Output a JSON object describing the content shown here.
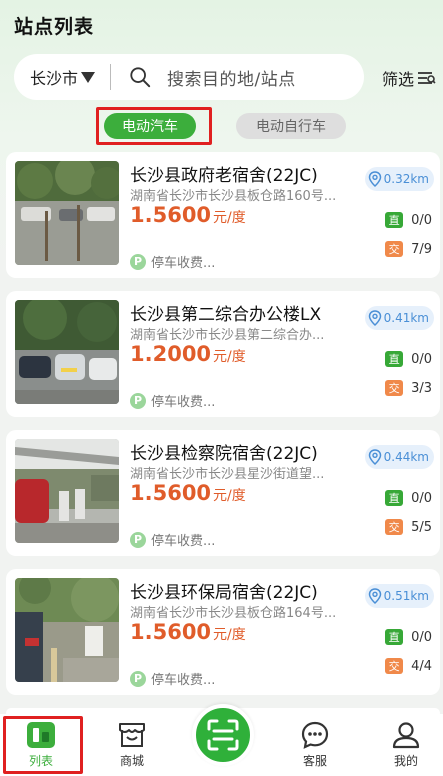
{
  "header": {
    "title": "站点列表"
  },
  "search": {
    "city": "长沙市",
    "placeholder": "搜索目的地/站点",
    "filter_label": "筛选"
  },
  "tabs": [
    {
      "label": "电动汽车",
      "active": true
    },
    {
      "label": "电动自行车",
      "active": false
    }
  ],
  "stations": [
    {
      "name": "长沙县政府老宿舍(22JC)",
      "address": "湖南省长沙市长沙县板仓路160号...",
      "price": "1.5600",
      "price_unit": "元/度",
      "parking": "停车收费...",
      "distance": "0.32km",
      "direct_label": "直",
      "direct": "0/0",
      "ac_label": "交",
      "ac": "7/9",
      "thumb_icon": "parking-lot-photo"
    },
    {
      "name": "长沙县第二综合办公楼LX",
      "address": "湖南省长沙市长沙县第二综合办...",
      "price": "1.2000",
      "price_unit": "元/度",
      "parking": "停车收费...",
      "distance": "0.41km",
      "direct_label": "直",
      "direct": "0/0",
      "ac_label": "交",
      "ac": "3/3",
      "thumb_icon": "parking-lot-photo"
    },
    {
      "name": "长沙县检察院宿舍(22JC)",
      "address": "湖南省长沙市长沙县星沙街道望...",
      "price": "1.5600",
      "price_unit": "元/度",
      "parking": "停车收费...",
      "distance": "0.44km",
      "direct_label": "直",
      "direct": "0/0",
      "ac_label": "交",
      "ac": "5/5",
      "thumb_icon": "carport-photo"
    },
    {
      "name": "长沙县环保局宿舍(22JC)",
      "address": "湖南省长沙市长沙县板仓路164号...",
      "price": "1.5600",
      "price_unit": "元/度",
      "parking": "停车收费...",
      "distance": "0.51km",
      "direct_label": "直",
      "direct": "0/0",
      "ac_label": "交",
      "ac": "4/4",
      "thumb_icon": "charger-photo"
    }
  ],
  "nav": [
    {
      "label": "列表",
      "icon": "list-icon",
      "active": true
    },
    {
      "label": "商城",
      "icon": "shop-icon",
      "active": false
    },
    {
      "label": "",
      "icon": "scan-icon",
      "active": false
    },
    {
      "label": "客服",
      "icon": "chat-icon",
      "active": false
    },
    {
      "label": "我的",
      "icon": "user-icon",
      "active": false
    }
  ],
  "colors": {
    "primary": "#3cae3c",
    "price": "#e05c2a",
    "distance": "#4a8fd6",
    "ac_badge": "#f0894a",
    "highlight": "#e02020"
  }
}
